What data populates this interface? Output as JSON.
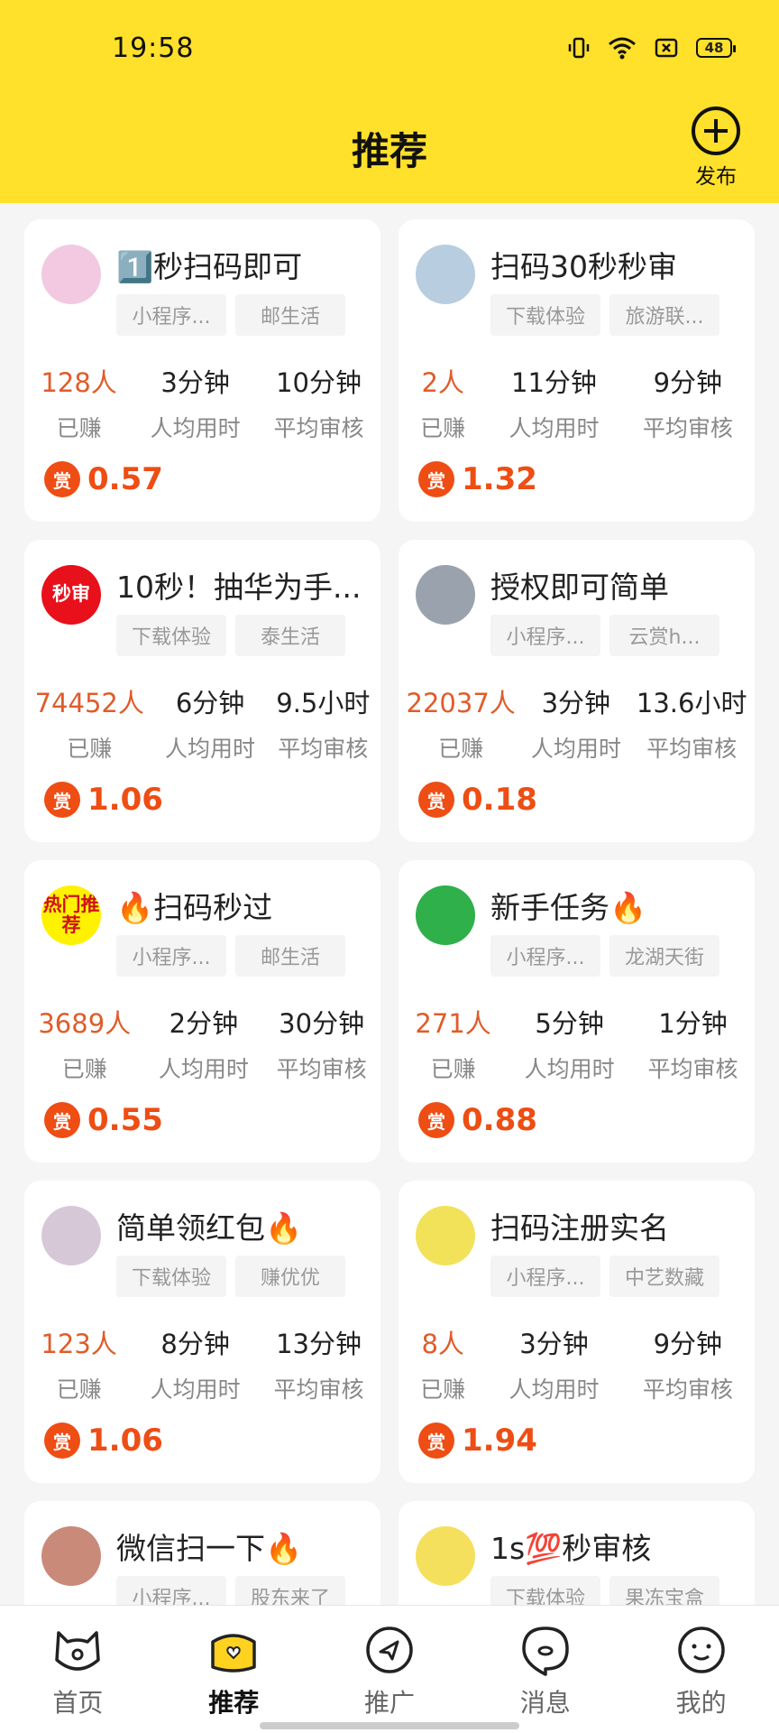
{
  "status_bar": {
    "time": "19:58",
    "battery": "48"
  },
  "header": {
    "title": "推荐",
    "publish_label": "发布"
  },
  "stat_labels": {
    "earned": "已赚",
    "avg_time": "人均用时",
    "avg_review": "平均审核"
  },
  "reward_badge": "赏",
  "cards": [
    {
      "title": "1️⃣秒扫码即可",
      "tags": [
        "小程序...",
        "邮生活"
      ],
      "earned": "128人",
      "avg_time": "3分钟",
      "avg_review": "10分钟",
      "reward": "0.57",
      "avatar_text": "",
      "avatar_color": "#f2c9e0"
    },
    {
      "title": "扫码30秒秒审",
      "tags": [
        "下载体验",
        "旅游联..."
      ],
      "earned": "2人",
      "avg_time": "11分钟",
      "avg_review": "9分钟",
      "reward": "1.32",
      "avatar_text": "",
      "avatar_color": "#b8cde0"
    },
    {
      "title": "10秒！抽华为手...",
      "tags": [
        "下载体验",
        "泰生活"
      ],
      "earned": "74452人",
      "avg_time": "6分钟",
      "avg_review": "9.5小时",
      "reward": "1.06",
      "avatar_text": "秒审",
      "avatar_color": "#e8101a"
    },
    {
      "title": "授权即可简单",
      "tags": [
        "小程序...",
        "云赏h..."
      ],
      "earned": "22037人",
      "avg_time": "3分钟",
      "avg_review": "13.6小时",
      "reward": "0.18",
      "avatar_text": "",
      "avatar_color": "#9aa3ad"
    },
    {
      "title": "🔥扫码秒过",
      "tags": [
        "小程序...",
        "邮生活"
      ],
      "earned": "3689人",
      "avg_time": "2分钟",
      "avg_review": "30分钟",
      "reward": "0.55",
      "avatar_text": "热门推荐",
      "avatar_color": "#fff200"
    },
    {
      "title": "新手任务🔥",
      "tags": [
        "小程序...",
        "龙湖天街"
      ],
      "earned": "271人",
      "avg_time": "5分钟",
      "avg_review": "1分钟",
      "reward": "0.88",
      "avatar_text": "",
      "avatar_color": "#2fb04a"
    },
    {
      "title": "简单领红包🔥",
      "tags": [
        "下载体验",
        "赚优优"
      ],
      "earned": "123人",
      "avg_time": "8分钟",
      "avg_review": "13分钟",
      "reward": "1.06",
      "avatar_text": "",
      "avatar_color": "#d7c8d8"
    },
    {
      "title": "扫码注册实名",
      "tags": [
        "小程序...",
        "中艺数藏"
      ],
      "earned": "8人",
      "avg_time": "3分钟",
      "avg_review": "9分钟",
      "reward": "1.94",
      "avatar_text": "",
      "avatar_color": "#f1e25a"
    },
    {
      "title": "微信扫一下🔥",
      "tags": [
        "小程序...",
        "股东来了"
      ],
      "earned": "",
      "avg_time": "",
      "avg_review": "",
      "reward": "",
      "avatar_text": "",
      "avatar_color": "#c98a7a"
    },
    {
      "title": "1s💯秒审核",
      "tags": [
        "下载体验",
        "果冻宝盒"
      ],
      "earned": "",
      "avg_time": "",
      "avg_review": "",
      "reward": "",
      "avatar_text": "",
      "avatar_color": "#f5e05e"
    }
  ],
  "tabbar": [
    {
      "label": "首页",
      "icon": "cat-face-icon",
      "active": false
    },
    {
      "label": "推荐",
      "icon": "heart-bag-icon",
      "active": true
    },
    {
      "label": "推广",
      "icon": "send-icon",
      "active": false
    },
    {
      "label": "消息",
      "icon": "chat-bubble-icon",
      "active": false
    },
    {
      "label": "我的",
      "icon": "smile-face-icon",
      "active": false
    }
  ]
}
